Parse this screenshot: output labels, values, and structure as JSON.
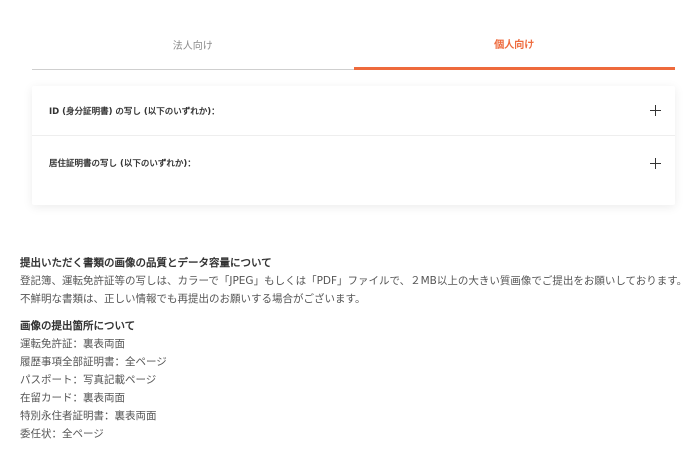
{
  "tabs": [
    {
      "label": "法人向け",
      "active": false
    },
    {
      "label": "個人向け",
      "active": true
    }
  ],
  "accordion": [
    {
      "label": "ID (身分証明書) の写し (以下のいずれか)："
    },
    {
      "label": "居住証明書の写し (以下のいずれか)："
    }
  ],
  "quality": {
    "heading": "提出いただく書類の画像の品質とデータ容量について",
    "lines": [
      "登記簿、運転免許証等の写しは、カラーで「JPEG」もしくは「PDF」ファイルで、２MB以上の大きい質画像でご提出をお願いしております。",
      "不鮮明な書類は、正しい情報でも再提出のお願いする場合がございます。"
    ]
  },
  "areas": {
    "heading": "画像の提出箇所について",
    "lines": [
      "運転免許証：裏表両面",
      "履歴事項全部証明書：全ページ",
      "パスポート：写真記載ページ",
      "在留カード：裏表両面",
      "特別永住者証明書：裏表両面",
      "委任状：全ページ"
    ]
  },
  "colors": {
    "accent": "#ee6a3c",
    "text": "#333333",
    "muted": "#8a8a8a"
  },
  "icons": {
    "expand": "plus-icon"
  }
}
